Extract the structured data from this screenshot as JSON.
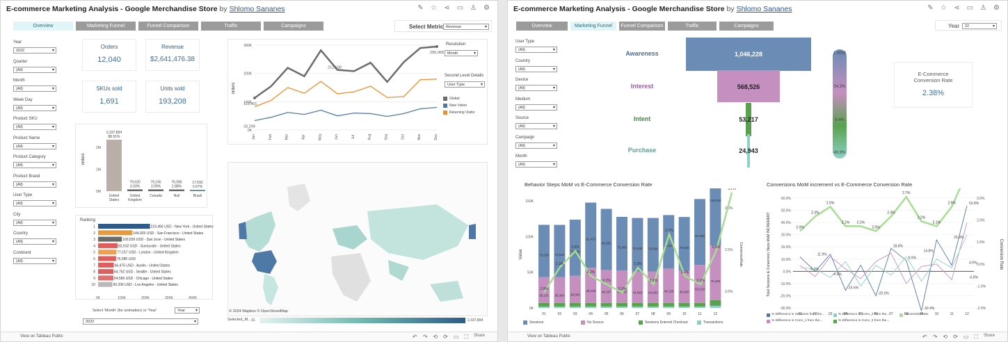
{
  "left": {
    "title": "E-commerce Marketing Analysis - Google Merchandise Store",
    "by": "by",
    "author": "Shlomo Sananes",
    "tabs": [
      "Overview",
      "Marketing Funnel",
      "Funnel Comparison",
      "Traffic",
      "Campaigns"
    ],
    "select_metric_label": "Select Metric",
    "select_metric_value": "Revenue",
    "filters": [
      {
        "label": "Year",
        "value": "2022"
      },
      {
        "label": "Quarter",
        "value": "(All)"
      },
      {
        "label": "Month",
        "value": "(All)"
      },
      {
        "label": "Week Day",
        "value": "(All)"
      },
      {
        "label": "Product SKU",
        "value": "(All)"
      },
      {
        "label": "Product Name",
        "value": "(All)"
      },
      {
        "label": "Product Category",
        "value": "(All)"
      },
      {
        "label": "Product Brand",
        "value": "(All)"
      },
      {
        "label": "User Type",
        "value": "(All)"
      },
      {
        "label": "City",
        "value": "(All)"
      },
      {
        "label": "Country",
        "value": "(All)"
      },
      {
        "label": "Continent",
        "value": "(All)"
      }
    ],
    "kpis": [
      {
        "label": "Orders",
        "value": "12,040"
      },
      {
        "label": "Revenue",
        "value": "$2,641,476.38"
      },
      {
        "label": "SKUs sold",
        "value": "1,691"
      },
      {
        "label": "Units sold",
        "value": "193,208"
      }
    ],
    "resolution_label": "Resolution",
    "resolution_value": "Month",
    "second_level_label": "Second Level Details",
    "second_level_value": "User Type",
    "line_legend": [
      "Global",
      "New Visitor",
      "Returning Visitor"
    ],
    "ranking_label": "Ranking",
    "animation_label": "Select 'Month' (for animation) or 'Year'",
    "animation_value": "Year",
    "animation_year": "2022",
    "map_credit": "© 2024 Mapbox © OpenStreetMap",
    "map_legend_label": "Selected_M...",
    "map_legend_min": "31",
    "map_legend_max": "2,337,894",
    "footer": "View on Tableau Public",
    "share": "Share"
  },
  "right": {
    "title": "E-commerce Marketing Analysis - Google Merchandise Store",
    "by": "by",
    "author": "Shlomo Sananes",
    "tabs": [
      "Overview",
      "Marketing Funnel",
      "Funnel Comparison",
      "Traffic",
      "Campaigns"
    ],
    "year_label": "Year",
    "year_value": "22",
    "filters": [
      {
        "label": "User Type",
        "value": "(All)"
      },
      {
        "label": "Country",
        "value": "(All)"
      },
      {
        "label": "Device",
        "value": "(All)"
      },
      {
        "label": "Medium",
        "value": "(All)"
      },
      {
        "label": "Source",
        "value": "(All)"
      },
      {
        "label": "Campaign",
        "value": "(All)"
      },
      {
        "label": "Month",
        "value": "(All)"
      }
    ],
    "funnel": [
      {
        "stage": "Awareness",
        "value": "1,046,228",
        "pct": "1.0000"
      },
      {
        "stage": "Interest",
        "value": "568,526",
        "pct": "54.3%"
      },
      {
        "stage": "Intent",
        "value": "53,217",
        "pct": "9.4%"
      },
      {
        "stage": "Purchase",
        "value": "24,943",
        "pct": "46.9%"
      }
    ],
    "conv_label": "E-Commerce Conversion Rate",
    "conv_value": "2.38%",
    "behavior_title": "Behavior Steps MoM  vs  E-Commerce Conversion Rate",
    "conversions_title": "Conversions MoM increment  vs  E-Commerce Conversion Rate",
    "behavior_legend": [
      "Sessions",
      "No Source",
      "Sessions Entered Checkout",
      "Transactions"
    ],
    "conv_legend": [
      "% Difference in Sessions from the...",
      "% Difference in Conv_1 from the...",
      "% Difference in Conv_2 from the...",
      "% Difference in Conv_3 from the...",
      "ConversionRate"
    ],
    "footer": "View on Tableau Public",
    "share": "Share"
  },
  "chart_data": [
    {
      "type": "line",
      "title": "",
      "ylabel": "orders",
      "categories": [
        "Jan",
        "Feb",
        "Mar",
        "Apr",
        "May",
        "Jun",
        "Jul",
        "Aug",
        "Sep",
        "Oct",
        "Nov",
        "Dec"
      ],
      "ylim": [
        0,
        300000
      ],
      "yticks": [
        "0K",
        "100K",
        "200K",
        "300K"
      ],
      "series": [
        {
          "name": "Global",
          "color": "#6b6b6b",
          "values": [
            113401,
            155000,
            220000,
            190000,
            282000,
            212630,
            208000,
            238000,
            170000,
            240000,
            290000,
            295068
          ]
        },
        {
          "name": "New Visitor",
          "color": "#4e79a7",
          "values": [
            33299,
            45000,
            62000,
            55000,
            70000,
            50000,
            60000,
            58000,
            48000,
            58000,
            75000,
            80000
          ]
        },
        {
          "name": "Returning Visitor",
          "color": "#f28e2b",
          "values": [
            82000,
            105000,
            150000,
            130000,
            172000,
            128000,
            135000,
            155000,
            115000,
            118000,
            178000,
            180000
          ]
        }
      ],
      "labels": [
        "113,401",
        "212,630",
        "295,068",
        "33,299"
      ]
    },
    {
      "type": "bar",
      "ylabel": "orders",
      "categories": [
        "United States",
        "United Kingdom",
        "Canada",
        "Null",
        "Brazil"
      ],
      "values": [
        2337894,
        79920,
        79245,
        76085,
        17592
      ],
      "pct": [
        "88.51%",
        "3.03%",
        "3.00%",
        "2.88%",
        "0.67%"
      ],
      "value_labels": [
        "2,337,894",
        "79,920",
        "79,245",
        "76,085",
        "17,592"
      ],
      "yticks": [
        "0M",
        "1M",
        "2M"
      ]
    },
    {
      "type": "bar",
      "orientation": "horizontal",
      "xticks": [
        "0K",
        "100K",
        "200K",
        "300K",
        "400K"
      ],
      "rows": [
        {
          "rank": "1",
          "label": "219,456 USD - New York - United States",
          "value": 219456,
          "color": "#2e5b8a"
        },
        {
          "rank": "2",
          "label": "144,925 USD - San Francisco - United States",
          "value": 144925,
          "color": "#e89b3c"
        },
        {
          "rank": "3",
          "label": "100,559 USD - San Jose - United States",
          "value": 100559,
          "color": "#6b6b6b"
        },
        {
          "rank": "4",
          "label": "82,632 USD - Sunnyvale - United States",
          "value": 82632,
          "color": "#e05d5d"
        },
        {
          "rank": "5",
          "label": "77,157 USD - London - United Kingdom",
          "value": 77157,
          "color": "#f0a050"
        },
        {
          "rank": "6",
          "label": "76,085 USD",
          "value": 76085,
          "color": "#e05d5d"
        },
        {
          "rank": "7",
          "label": "66,475 USD - Austin - United States",
          "value": 66475,
          "color": "#e05d5d"
        },
        {
          "rank": "8",
          "label": "64,752 USD - Seattle - United States",
          "value": 64752,
          "color": "#e05d5d"
        },
        {
          "rank": "9",
          "label": "64,586 USD - Chicago - United States",
          "value": 64586,
          "color": "#e07070"
        },
        {
          "rank": "10",
          "label": "60,336 USD - Los Angeles - United States",
          "value": 60336,
          "color": "#b9b9b9"
        }
      ]
    },
    {
      "type": "bar",
      "title": "Behavior Steps MoM  vs  E-Commerce Conversion Rate",
      "ylabel": "Value",
      "y2label": "ConversionRate",
      "categories": [
        "01",
        "02",
        "03",
        "04",
        "05",
        "06",
        "07",
        "08",
        "09",
        "10",
        "11",
        "12"
      ],
      "yticks": [
        "0K",
        "50K",
        "100K",
        "150K"
      ],
      "y2ticks": [
        "2.0%",
        "2.5%",
        "3.0%"
      ],
      "series": [
        {
          "name": "Sessions",
          "color": "#6b8cb5",
          "values": [
            73339,
            73044,
            78749,
            91472,
            85655,
            75000,
            75000,
            75000,
            75000,
            75000,
            92288,
            145000
          ]
        },
        {
          "name": "No Source",
          "color": "#c58fc0",
          "values": [
            36131,
            36360,
            38000,
            49139,
            46197,
            45643,
            44083,
            44063,
            48139,
            45460,
            53319,
            76450
          ]
        },
        {
          "name": "Sessions Entered Checkout",
          "color": "#59a14f",
          "values": [
            5000,
            5000,
            5000,
            5000,
            5000,
            5000,
            5000,
            5000,
            5000,
            5000,
            5000,
            8000
          ]
        },
        {
          "name": "Transactions",
          "color": "#8cd1c4",
          "values": [
            2000,
            2000,
            2000,
            2000,
            2000,
            2000,
            2000,
            2000,
            2000,
            2000,
            2000,
            3000
          ]
        }
      ],
      "conversion_rate": [
        2.0,
        2.3,
        2.5,
        2.2,
        2.1,
        2.0,
        2.3,
        2.1,
        2.7,
        2.2,
        2.1,
        2.5,
        3.2
      ]
    },
    {
      "type": "line",
      "title": "Conversions MoM increment  vs  E-Commerce Conversion Rate",
      "ylabel": "Total Sessions & Conversion Steps MoM INCREMENT",
      "y2label": "Conversion Rate",
      "categories": [
        "01",
        "02",
        "03",
        "04",
        "05",
        "06",
        "07",
        "08",
        "09",
        "10",
        "11",
        "12"
      ],
      "yticks": [
        "-30.0%",
        "-20.0%",
        "-10.0%",
        "0.0%",
        "10.0%",
        "20.0%",
        "30.0%",
        "40.0%",
        "50.0%",
        "60.0%"
      ],
      "y2ticks": [
        "-2.0%",
        "-1.0%",
        "0.0%",
        "1.0%",
        "2.0%",
        "3.0%"
      ],
      "conversion_rate": [
        2.0,
        2.3,
        2.5,
        2.1,
        2.1,
        2.0,
        2.3,
        2.7,
        2.2,
        2.1,
        2.5,
        3.2
      ],
      "labels": [
        "11.9%",
        "-0.1%",
        "-4.3%",
        "-15.6%",
        "-20.0%",
        "18.8%",
        "8.9%",
        "14.8%",
        "-32.4%",
        "25.8%",
        "4.9%",
        "-6.8%",
        "53.8%"
      ]
    }
  ]
}
